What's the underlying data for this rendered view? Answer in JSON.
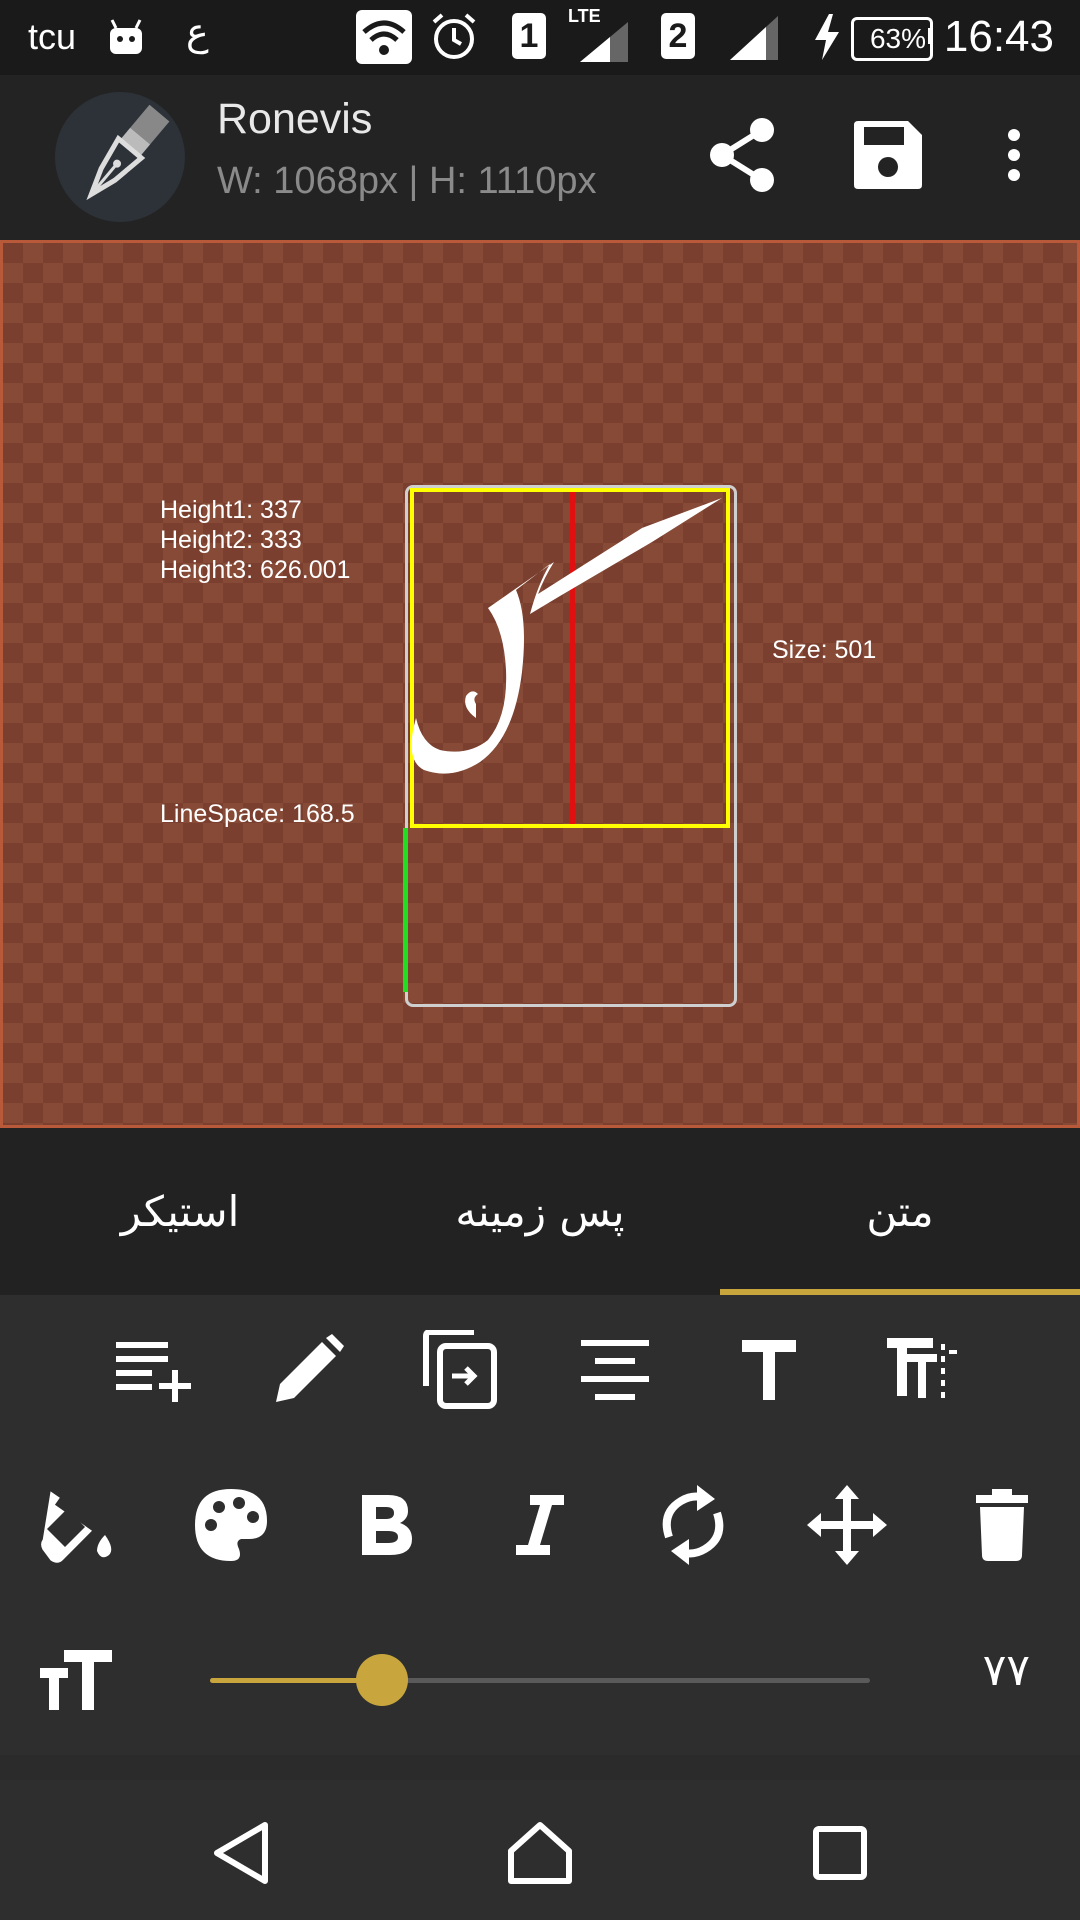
{
  "status_bar": {
    "left_glyphs": [
      "tcu",
      "ع"
    ],
    "sim1": "1",
    "sim1_network": "LTE",
    "sim2": "2",
    "battery_percent": 63,
    "battery_label": "63%",
    "time": "16:43"
  },
  "app_bar": {
    "title": "Ronevis",
    "subtitle": "W: 1068px | H: 1110px",
    "actions": [
      "share-icon",
      "save-icon",
      "more-vert-icon"
    ]
  },
  "canvas": {
    "info": {
      "height1": "Height1: 337",
      "height2": "Height2: 333",
      "height3": "Height3: 626.001",
      "line_space": "LineSpace: 168.5",
      "size": "Size: 501"
    },
    "glyph": "ک",
    "colors": {
      "background": "#7a3f2e",
      "checker": "#874a37",
      "bounding_box": "#ffff00",
      "center_line": "#e01010",
      "line_space_marker": "#22dd22"
    }
  },
  "tabs": [
    {
      "label": "استیکر",
      "selected": false
    },
    {
      "label": "پس زمینه",
      "selected": false
    },
    {
      "label": "متن",
      "selected": true
    }
  ],
  "tools_row1": [
    "add-line-icon",
    "edit-pencil-icon",
    "duplicate-icon",
    "align-center-icon",
    "text-icon",
    "text-spacing-icon"
  ],
  "tools_row2": [
    "fill-bucket-icon",
    "palette-icon",
    "bold-icon",
    "italic-icon",
    "rotate-icon",
    "move-icon",
    "delete-icon"
  ],
  "size_slider": {
    "icon": "text-size-icon",
    "fraction": 0.26,
    "value": "۷۷"
  },
  "accent_color": "#c9a53d",
  "nav_bar": [
    "back-icon",
    "home-icon",
    "recents-icon"
  ]
}
